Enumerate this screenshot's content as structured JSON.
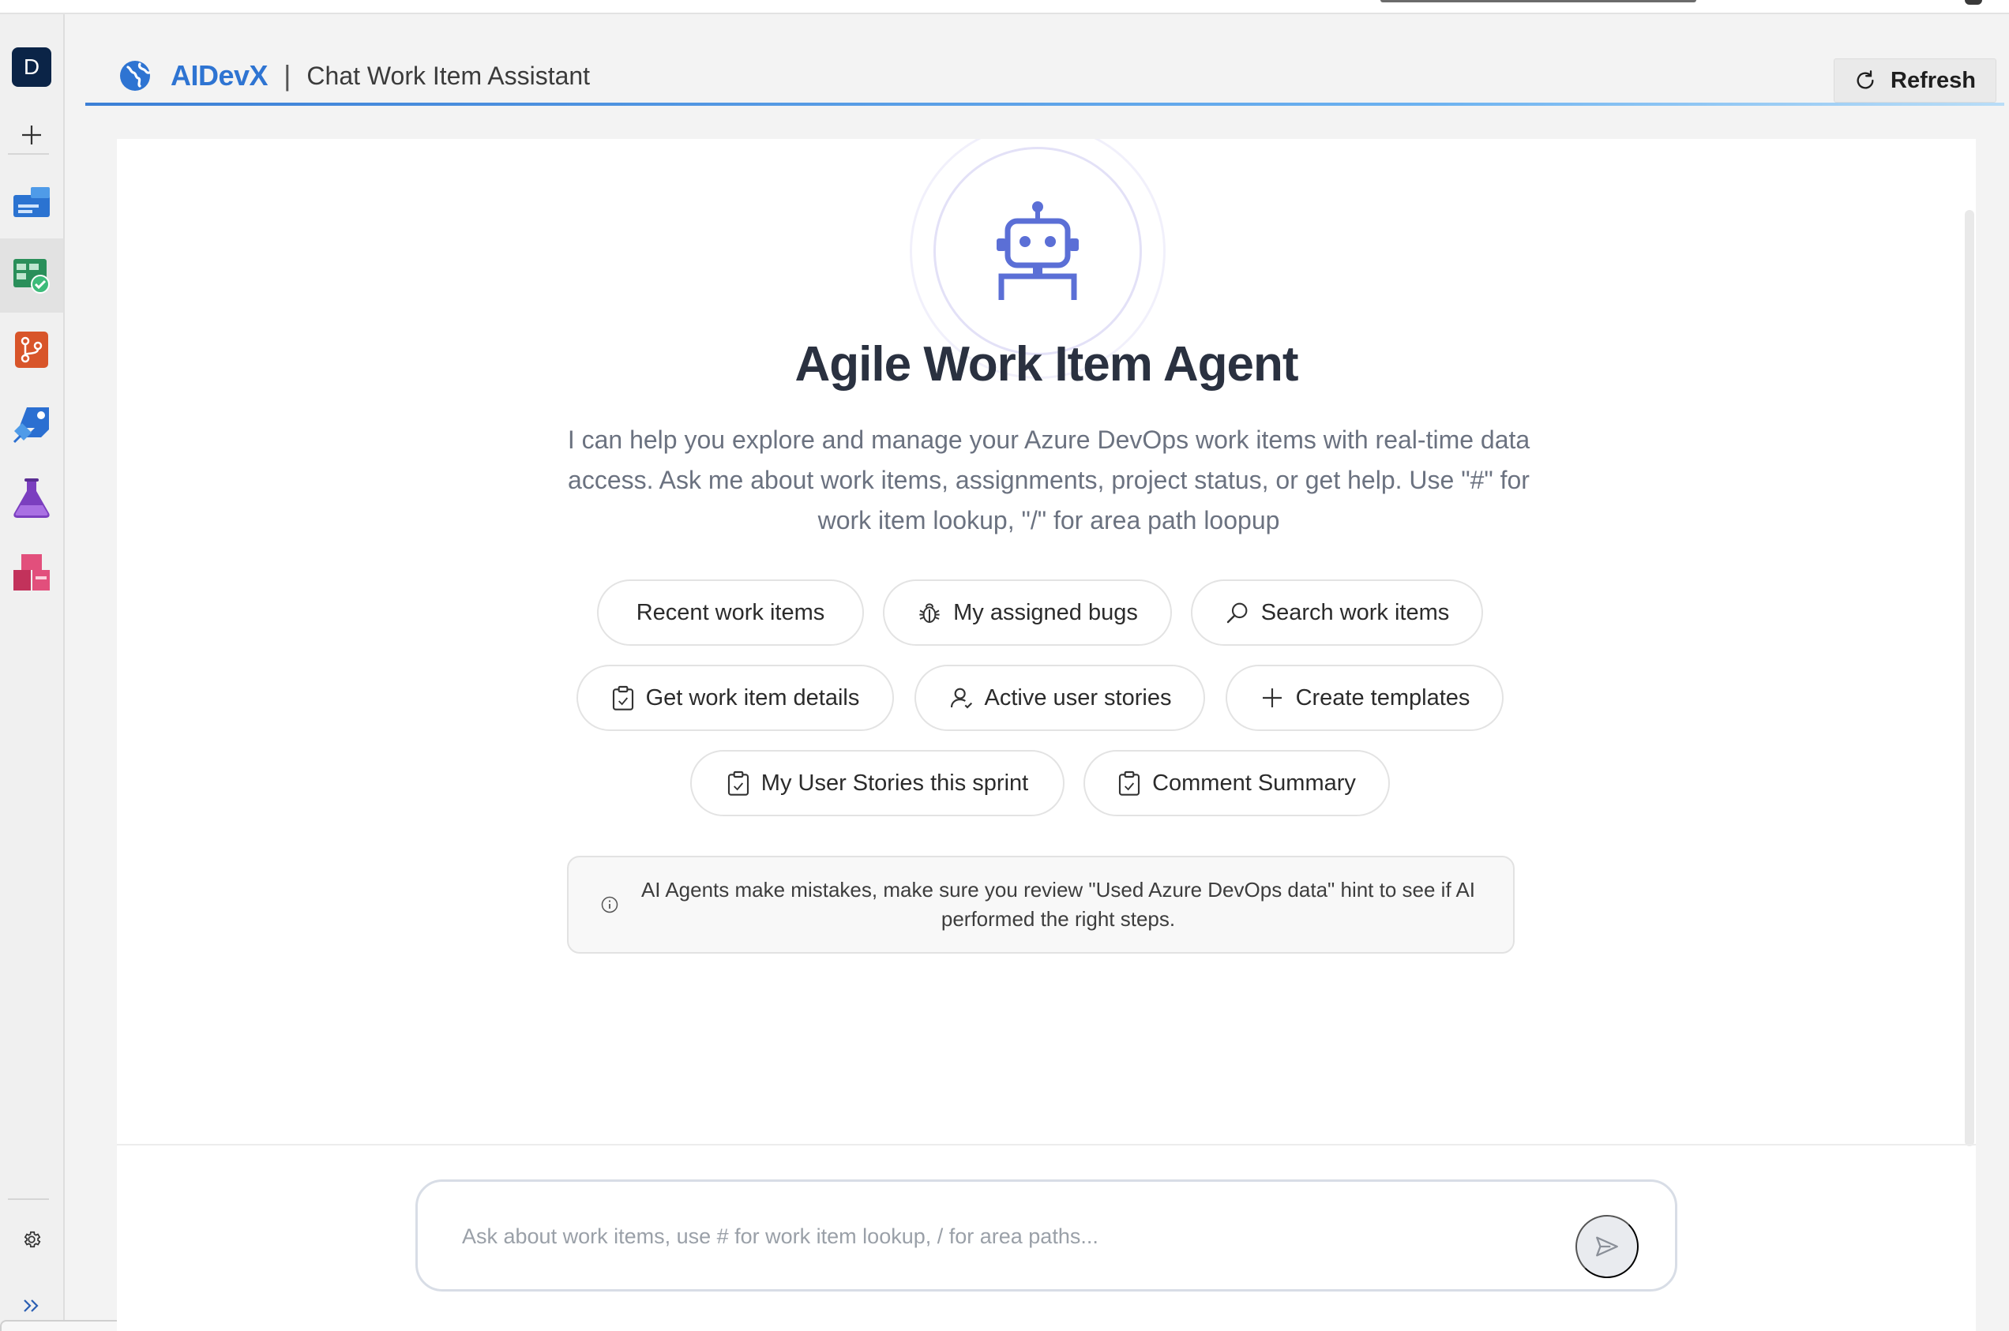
{
  "rail": {
    "org_initial": "D",
    "items": [
      {
        "name": "new-item",
        "icon": "plus-icon"
      },
      {
        "name": "overview",
        "icon": "overview-icon",
        "color": "#2b73d1"
      },
      {
        "name": "boards",
        "icon": "boards-icon",
        "color": "#2a8f5a",
        "active": true
      },
      {
        "name": "repos",
        "icon": "repos-icon",
        "color": "#d8552a"
      },
      {
        "name": "pipelines",
        "icon": "pipelines-icon",
        "color": "#2b6fd1"
      },
      {
        "name": "test-plans",
        "icon": "flask-icon",
        "color": "#7b3fbf"
      },
      {
        "name": "artifacts",
        "icon": "artifacts-icon",
        "color": "#c2325b"
      }
    ],
    "settings_icon": "gear-icon",
    "expand_icon": "double-chevron-right-icon"
  },
  "header": {
    "brand": "AIDevX",
    "separator": "|",
    "subtitle": "Chat Work Item Assistant",
    "refresh_label": "Refresh",
    "accent": "#2e74d2"
  },
  "main": {
    "title": "Agile Work Item Agent",
    "description": "I can help you explore and manage your Azure DevOps work items with real-time data access. Ask me about work items, assignments, project status, or get help. Use \"#\" for work item lookup, \"/\" for area path loopup",
    "suggestions": [
      {
        "label": "Recent work items",
        "icon": "none"
      },
      {
        "label": "My assigned bugs",
        "icon": "bug-icon"
      },
      {
        "label": "Search work items",
        "icon": "search-icon"
      },
      {
        "label": "Get work item details",
        "icon": "clipboard-icon"
      },
      {
        "label": "Active user stories",
        "icon": "user-icon"
      },
      {
        "label": "Create templates",
        "icon": "plus-icon"
      },
      {
        "label": "My User Stories this sprint",
        "icon": "clipboard-icon"
      },
      {
        "label": "Comment Summary",
        "icon": "clipboard-icon"
      }
    ],
    "notice": "AI Agents make mistakes, make sure you review \"Used Azure DevOps data\" hint to see if AI performed the right steps."
  },
  "composer": {
    "placeholder": "Ask about work items, use # for work item lookup, / for area paths...",
    "value": ""
  },
  "colors": {
    "robot": "#5b6fd6",
    "panel_bg": "#ffffff",
    "rail_bg": "#f0f0f0"
  }
}
